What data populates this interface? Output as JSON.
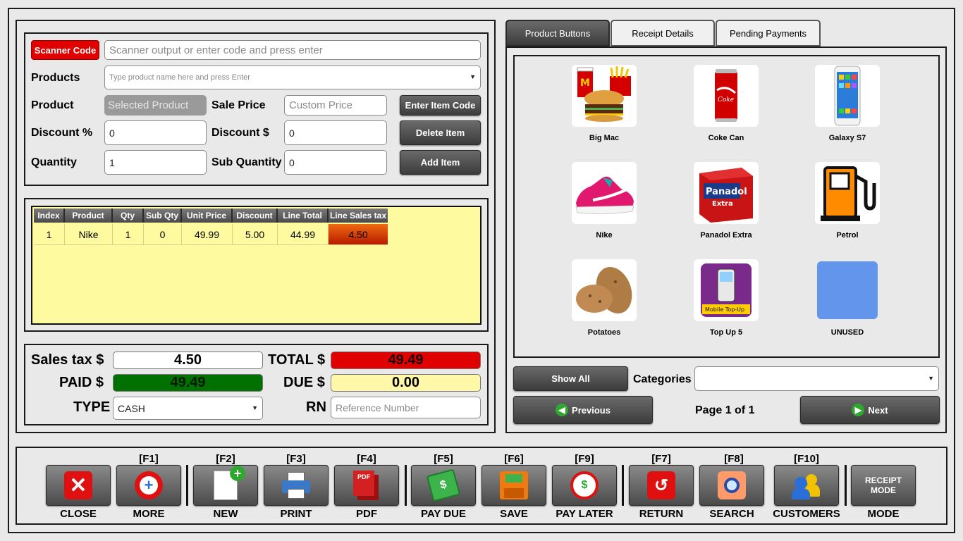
{
  "entry": {
    "scanner_label": "Scanner Code",
    "scanner_placeholder": "Scanner output or enter code and press enter",
    "products_label": "Products",
    "products_placeholder": "Type product name here and press Enter",
    "product_label": "Product",
    "product_value": "Selected Product",
    "sale_price_label": "Sale Price",
    "sale_price_placeholder": "Custom Price",
    "enter_item_code": "Enter Item Code",
    "discount_pct_label": "Discount %",
    "discount_pct_value": "0",
    "discount_amt_label": "Discount $",
    "discount_amt_value": "0",
    "delete_item": "Delete Item",
    "quantity_label": "Quantity",
    "quantity_value": "1",
    "sub_quantity_label": "Sub Quantity",
    "sub_quantity_value": "0",
    "add_item": "Add Item"
  },
  "grid": {
    "headers": [
      "Index",
      "Product",
      "Qty",
      "Sub Qty",
      "Unit Price",
      "Discount",
      "Line Total",
      "Line Sales tax"
    ],
    "rows": [
      [
        "1",
        "Nike",
        "1",
        "0",
        "49.99",
        "5.00",
        "44.99",
        "4.50"
      ]
    ]
  },
  "totals": {
    "sales_tax_label": "Sales tax $",
    "sales_tax_value": "4.50",
    "total_label": "TOTAL $",
    "total_value": "49.49",
    "paid_label": "PAID $",
    "paid_value": "49.49",
    "due_label": "DUE $",
    "due_value": "0.00",
    "type_label": "TYPE",
    "type_value": "CASH",
    "rn_label": "RN",
    "rn_placeholder": "Reference Number"
  },
  "tabs": [
    "Product Buttons",
    "Receipt Details",
    "Pending Payments"
  ],
  "products": [
    {
      "name": "Big Mac",
      "icon": "burger-meal-icon"
    },
    {
      "name": "Coke Can",
      "icon": "soda-can-icon"
    },
    {
      "name": "Galaxy S7",
      "icon": "smartphone-icon"
    },
    {
      "name": "Nike",
      "icon": "sneaker-icon"
    },
    {
      "name": "Panadol Extra",
      "icon": "medicine-box-icon"
    },
    {
      "name": "Petrol",
      "icon": "fuel-pump-icon"
    },
    {
      "name": "Potatoes",
      "icon": "potato-icon"
    },
    {
      "name": "Top Up 5",
      "icon": "mobile-topup-icon"
    },
    {
      "name": "UNUSED",
      "icon": "blank-tile-icon"
    }
  ],
  "product_nav": {
    "show_all": "Show All",
    "categories_label": "Categories",
    "previous": "Previous",
    "next": "Next",
    "page": "Page 1 of 1"
  },
  "toolbar": [
    {
      "key": "",
      "label": "CLOSE",
      "icon": "close-icon"
    },
    {
      "key": "[F1]",
      "label": "MORE",
      "icon": "more-icon"
    },
    {
      "key": "[F2]",
      "label": "NEW",
      "icon": "new-document-icon"
    },
    {
      "key": "[F3]",
      "label": "PRINT",
      "icon": "printer-icon"
    },
    {
      "key": "[F4]",
      "label": "PDF",
      "icon": "pdf-icon"
    },
    {
      "key": "[F5]",
      "label": "PAY DUE",
      "icon": "pay-due-icon"
    },
    {
      "key": "[F6]",
      "label": "SAVE",
      "icon": "save-icon"
    },
    {
      "key": "[F9]",
      "label": "PAY LATER",
      "icon": "pay-later-icon"
    },
    {
      "key": "[F7]",
      "label": "RETURN",
      "icon": "return-cart-icon"
    },
    {
      "key": "[F8]",
      "label": "SEARCH",
      "icon": "search-icon"
    },
    {
      "key": "[F10]",
      "label": "CUSTOMERS",
      "icon": "customers-icon"
    },
    {
      "key": "",
      "label": "MODE",
      "icon": "receipt-mode-icon",
      "button_text": "RECEIPT MODE"
    }
  ],
  "colors": {
    "scanner_red": "#e00000",
    "total_red": "#e00000",
    "paid_green": "#007000",
    "due_yellow": "#fff8a8",
    "grid_yellow": "#fdfaa0",
    "unused_blue": "#6495ed"
  }
}
